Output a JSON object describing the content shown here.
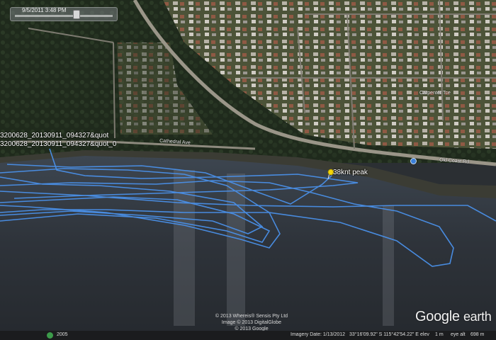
{
  "app": {
    "name": "Google Earth"
  },
  "time_slider": {
    "date_label": "9/5/2011 3:48 PM"
  },
  "track_labels": [
    "3200628_20130911_094327&quot",
    "3200628_20130911_094327&quot_0"
  ],
  "placemark": {
    "label": "38knt peak",
    "color": "#f5d60a"
  },
  "track_color": "#4a90e8",
  "road_labels": {
    "cathedral": "Cathedral Ave",
    "old_coast": "Old Coast Rd",
    "carpenter": "Carpenter Tce"
  },
  "copyright": [
    "© 2013 Whereis® Sensis Pty Ltd",
    "Image © 2013 DigitalGlobe",
    "© 2013 Google"
  ],
  "logo": {
    "brand": "Google",
    "product": "earth"
  },
  "status_bar": {
    "year": "2005",
    "imagery_date": "Imagery Date: 1/13/2012",
    "coordinates": "33°16'09.92\" S  115°42'54.22\" E",
    "elev_label": "elev",
    "elev_value": "1 m",
    "eye_alt_label": "eye alt",
    "eye_alt_value": "698 m"
  }
}
